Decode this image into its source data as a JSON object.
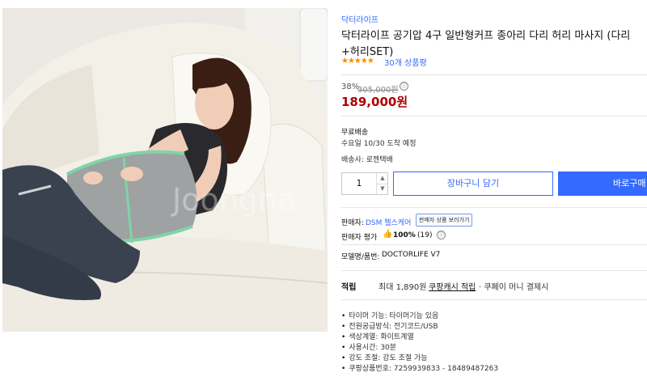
{
  "product": {
    "brand": "닥터라이프",
    "title_line1": "닥터라이프 공기압 4구 일반형커프 종아리 다리 허리 마사지 (다리",
    "title_line2": "+허리SET)",
    "stars": "★★★★★",
    "review_count": "30개 상품평"
  },
  "price": {
    "discount": "38%",
    "original": "305,000원",
    "info_icon": "ⓘ",
    "sale": "189,000원"
  },
  "shipping": {
    "free": "무료배송",
    "arrival": "수요일 10/30 도착 예정",
    "carrier": "배송사: 로젠택배"
  },
  "purchase": {
    "quantity": "1",
    "qty_up": "▲",
    "qty_down": "▼",
    "cart_label": "장바구니 담기",
    "buy_label": "바로구매"
  },
  "seller": {
    "label": "판매자:",
    "name": "DSM 헬스케어",
    "more_button": "판매자 상품 보러가기",
    "rating_label": "판매자 평가",
    "thumb_icon": "👍",
    "rating_value": "100%",
    "rating_count": "(19)",
    "info_icon": "ⓘ"
  },
  "model": {
    "label": "모델명/품번:",
    "value": "DOCTORLIFE V7"
  },
  "reward": {
    "label": "적립",
    "max": "최대 1,890원",
    "link": "쿠팡캐시 적립",
    "rest": "· 쿠페이 머니 결제시"
  },
  "specs": [
    "타이머 기능: 타이머기능 있음",
    "전원공급방식: 전기코드/USB",
    "색상계열: 화이트계열",
    "사용시간: 30분",
    "강도 조절: 강도 조절 가능",
    "쿠팡상품번호: 7259939833 - 18489487263"
  ],
  "photo": {
    "watermark": "Joongna"
  },
  "colors": {
    "accent": "#346aff",
    "price_red": "#ae0000",
    "star_orange": "#ff8a00"
  }
}
